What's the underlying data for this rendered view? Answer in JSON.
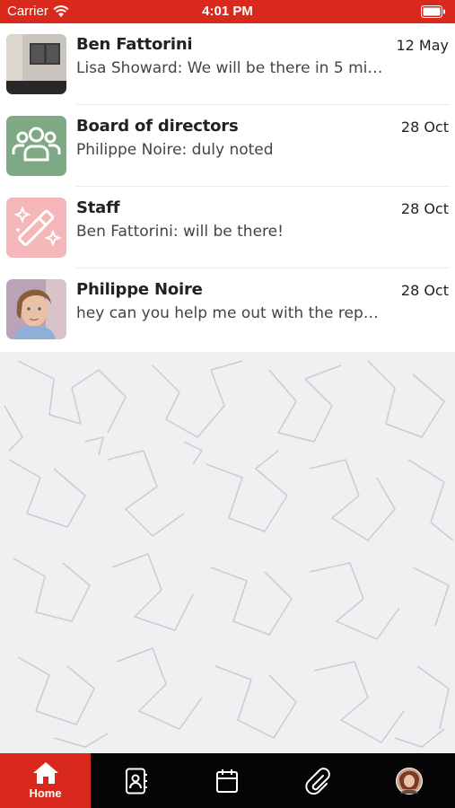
{
  "status_bar": {
    "carrier": "Carrier",
    "time": "4:01 PM"
  },
  "chats": [
    {
      "name": "Ben Fattorini",
      "date": "12 May",
      "preview": "Lisa Showard: We will be there in 5 mi…",
      "avatar": "photo-room-door"
    },
    {
      "name": "Board of directors",
      "date": "28 Oct",
      "preview": "Philippe Noire: duly noted",
      "avatar": "group-people-icon"
    },
    {
      "name": "Staff",
      "date": "28 Oct",
      "preview": "Ben Fattorini: will be there!",
      "avatar": "magic-wand-icon"
    },
    {
      "name": "Philippe Noire",
      "date": "28 Oct",
      "preview": "hey can you help me out with the repo…",
      "avatar": "photo-person"
    }
  ],
  "tabs": [
    {
      "label": "Home",
      "icon": "home-icon",
      "active": true
    },
    {
      "label": "",
      "icon": "contacts-icon",
      "active": false
    },
    {
      "label": "",
      "icon": "calendar-icon",
      "active": false
    },
    {
      "label": "",
      "icon": "paperclip-icon",
      "active": false
    },
    {
      "label": "",
      "icon": "profile-avatar",
      "active": false
    }
  ],
  "colors": {
    "accent": "#d9291c",
    "tab_bar": "#050505",
    "background": "#eef0f2",
    "group_avatar": "#7fa884",
    "staff_avatar": "#f4b6b8"
  }
}
